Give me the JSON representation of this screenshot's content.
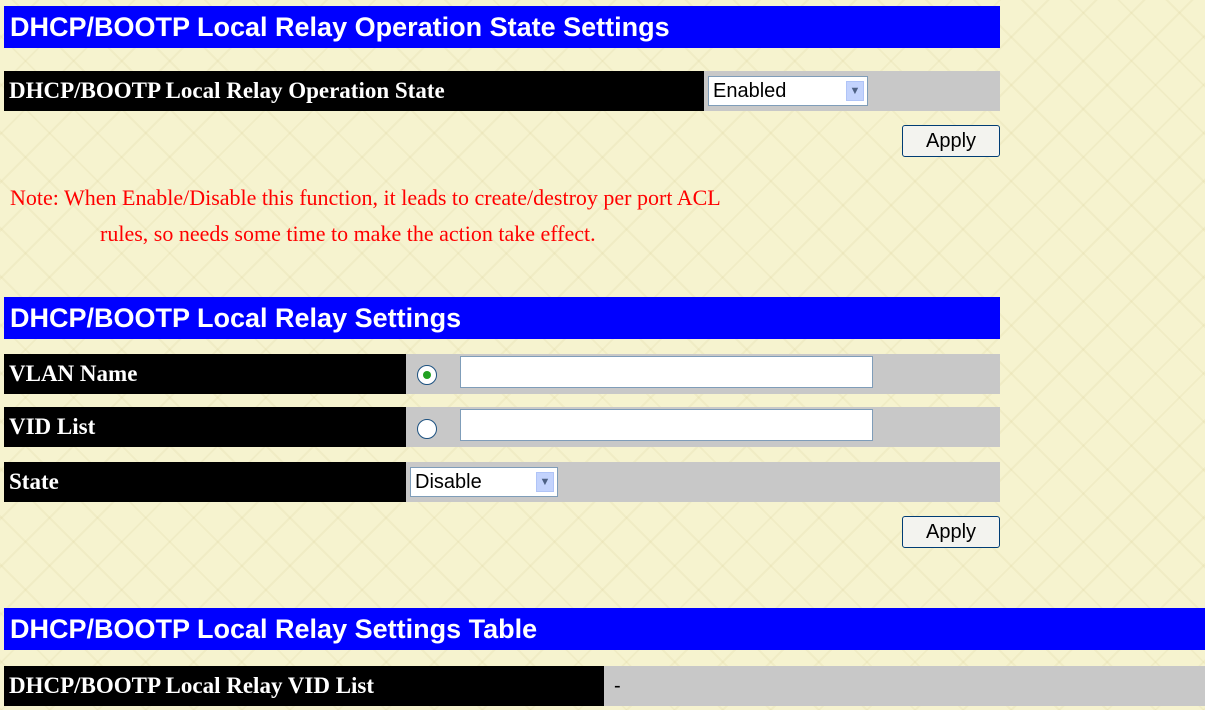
{
  "operation_state_section": {
    "title": "DHCP/BOOTP Local Relay Operation State Settings",
    "state_label": "DHCP/BOOTP Local Relay Operation State",
    "state_value": "Enabled",
    "apply_label": "Apply",
    "note_line1": "Note: When Enable/Disable this function, it leads to create/destroy per port ACL",
    "note_line2": "rules, so needs some time to make the action take effect."
  },
  "relay_settings_section": {
    "title": "DHCP/BOOTP Local Relay Settings",
    "vlan_name_label": "VLAN Name",
    "vlan_name_selected": true,
    "vlan_name_value": "",
    "vid_list_label": "VID List",
    "vid_list_selected": false,
    "vid_list_value": "",
    "state_label": "State",
    "state_value": "Disable",
    "apply_label": "Apply"
  },
  "relay_table_section": {
    "title": "DHCP/BOOTP Local Relay Settings Table",
    "vid_list_label": "DHCP/BOOTP Local Relay VID List",
    "vid_list_value": "-"
  },
  "icons": {
    "dropdown": "chevron-down-icon",
    "radio_selected": "radio-selected-icon",
    "radio_unselected": "radio-unselected-icon"
  },
  "colors": {
    "header_bg": "#0000ff",
    "label_bg": "#000000",
    "row_bg": "#c8c8c8",
    "note_text": "#ff0000"
  }
}
